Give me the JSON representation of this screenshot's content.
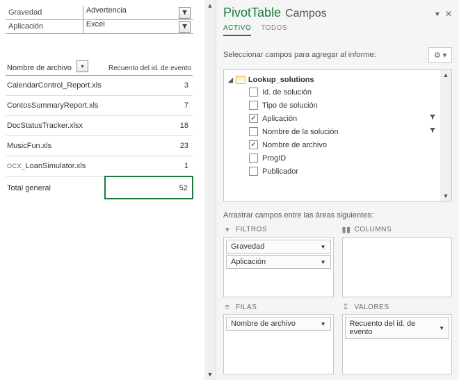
{
  "filters": {
    "rows": [
      {
        "label": "Gravedad",
        "value": "Advertencia"
      },
      {
        "label": "Aplicación",
        "value": "Excel"
      }
    ]
  },
  "headers": {
    "rowLabel": "Nombre de archivo",
    "valueLabel": "Recuento del id. de evento"
  },
  "rows": [
    {
      "name": "CalendarControl_Report.xls",
      "count": "3",
      "prefix": ""
    },
    {
      "name": "ContosSummaryReport.xls",
      "count": "7",
      "prefix": ""
    },
    {
      "name": "DocStatusTracker.xlsx",
      "count": "18",
      "prefix": ""
    },
    {
      "name": "MusicFun.xls",
      "count": "23",
      "prefix": ""
    },
    {
      "name": "LoanSimulator.xls",
      "count": "1",
      "prefix": "OCX_"
    }
  ],
  "total": {
    "label": "Total general",
    "value": "52"
  },
  "panel": {
    "title": "PivotTable",
    "subtitle": "Campos",
    "tabs": {
      "active": "ACTIVO",
      "all": "TODOS"
    },
    "selectLabel": "Seleccionar campos para agregar al informe:",
    "tableName": "Lookup_solutions",
    "fields": [
      {
        "label": "Id. de solución",
        "checked": false,
        "filter": false
      },
      {
        "label": "Tipo de solución",
        "checked": false,
        "filter": false
      },
      {
        "label": "Aplicación",
        "checked": true,
        "filter": true
      },
      {
        "label": "Nombre de la solución",
        "checked": false,
        "filter": true
      },
      {
        "label": "Nombre de archivo",
        "checked": true,
        "filter": false
      },
      {
        "label": "ProgID",
        "checked": false,
        "filter": false
      },
      {
        "label": "Publicador",
        "checked": false,
        "filter": false
      }
    ],
    "dragLabel": "Arrastrar campos entre las áreas siguientes:",
    "areas": {
      "filters": {
        "title": "FILTROS",
        "items": [
          "Gravedad",
          "Aplicación"
        ]
      },
      "columns": {
        "title": "COLUMNS",
        "items": []
      },
      "rows": {
        "title": "FILAS",
        "items": [
          "Nombre de archivo"
        ]
      },
      "values": {
        "title": "VALORES",
        "items": [
          "Recuento del id. de evento"
        ]
      }
    }
  }
}
